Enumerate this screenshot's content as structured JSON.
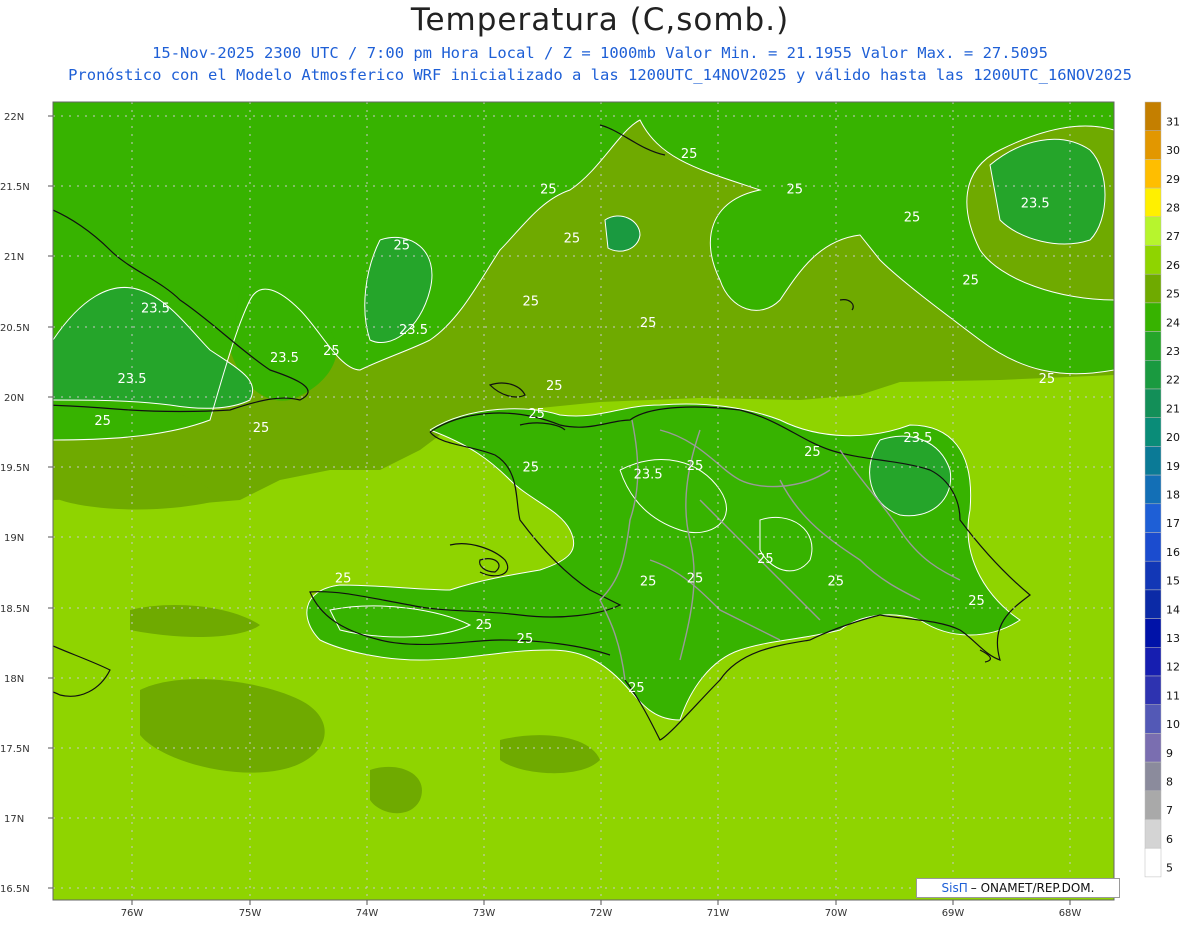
{
  "header": {
    "title": "Temperatura (C,somb.)",
    "line1": "15-Nov-2025  2300 UTC / 7:00 pm Hora Local / Z = 1000mb   Valor Min. = 21.1955  Valor Max. = 27.5095",
    "line2": "Pronóstico con el Modelo Atmosferico WRF inicializado a las 1200UTC_14NOV2025 y válido hasta las  1200UTC_16NOV2025"
  },
  "axes": {
    "lat_labels": [
      "22N",
      "21.5N",
      "21N",
      "20.5N",
      "20N",
      "19.5N",
      "19N",
      "18.5N",
      "18N",
      "17.5N",
      "17N",
      "16.5N"
    ],
    "lon_labels": [
      "76W",
      "75W",
      "74W",
      "73W",
      "72W",
      "71W",
      "70W",
      "69W",
      "68W"
    ]
  },
  "colorbar": {
    "levels": [
      "31",
      "30",
      "29",
      "28",
      "27",
      "26",
      "25",
      "24",
      "23",
      "22",
      "21",
      "20",
      "19",
      "18",
      "17",
      "16",
      "15",
      "14",
      "13",
      "12",
      "11",
      "10",
      "9",
      "8",
      "7",
      "6",
      "5"
    ],
    "colors": [
      "#c47f00",
      "#e29700",
      "#ffbe00",
      "#fff000",
      "#b7f52d",
      "#8fd400",
      "#6faa00",
      "#37b300",
      "#25a52a",
      "#1a9a40",
      "#138f58",
      "#0a8c78",
      "#0b7a96",
      "#136fb6",
      "#1e5fd6",
      "#1b4ccf",
      "#1237b6",
      "#0b2aa6",
      "#0012a8",
      "#161eb0",
      "#2e33b0",
      "#5359b6",
      "#7a6eb0",
      "#8b8b9c",
      "#a9a9a9",
      "#d4d4d4",
      "#ffffff"
    ]
  },
  "contour_labels": [
    {
      "text": "25",
      "lon": -72.45,
      "lat": 21.45
    },
    {
      "text": "25",
      "lon": -71.25,
      "lat": 21.7
    },
    {
      "text": "25",
      "lon": -70.35,
      "lat": 21.45
    },
    {
      "text": "25",
      "lon": -69.35,
      "lat": 21.25
    },
    {
      "text": "23.5",
      "lon": -68.3,
      "lat": 21.35
    },
    {
      "text": "25",
      "lon": -72.25,
      "lat": 21.1
    },
    {
      "text": "25",
      "lon": -73.7,
      "lat": 21.05
    },
    {
      "text": "25",
      "lon": -72.6,
      "lat": 20.65
    },
    {
      "text": "25",
      "lon": -71.6,
      "lat": 20.5
    },
    {
      "text": "25",
      "lon": -68.85,
      "lat": 20.8
    },
    {
      "text": "23.5",
      "lon": -75.8,
      "lat": 20.6
    },
    {
      "text": "23.5",
      "lon": -73.6,
      "lat": 20.45
    },
    {
      "text": "25",
      "lon": -74.3,
      "lat": 20.3
    },
    {
      "text": "23.5",
      "lon": -74.7,
      "lat": 20.25
    },
    {
      "text": "23.5",
      "lon": -76.0,
      "lat": 20.1
    },
    {
      "text": "25",
      "lon": -72.4,
      "lat": 20.05
    },
    {
      "text": "25",
      "lon": -68.2,
      "lat": 20.1
    },
    {
      "text": "25",
      "lon": -72.55,
      "lat": 19.85
    },
    {
      "text": "25",
      "lon": -76.25,
      "lat": 19.8
    },
    {
      "text": "25",
      "lon": -74.9,
      "lat": 19.75
    },
    {
      "text": "23.5",
      "lon": -69.3,
      "lat": 19.68
    },
    {
      "text": "25",
      "lon": -70.2,
      "lat": 19.58
    },
    {
      "text": "25",
      "lon": -71.2,
      "lat": 19.48
    },
    {
      "text": "25",
      "lon": -72.6,
      "lat": 19.47
    },
    {
      "text": "23.5",
      "lon": -71.6,
      "lat": 19.42
    },
    {
      "text": "25",
      "lon": -70.6,
      "lat": 18.82
    },
    {
      "text": "25",
      "lon": -74.2,
      "lat": 18.68
    },
    {
      "text": "25",
      "lon": -71.2,
      "lat": 18.68
    },
    {
      "text": "25",
      "lon": -71.6,
      "lat": 18.66
    },
    {
      "text": "25",
      "lon": -70.0,
      "lat": 18.66
    },
    {
      "text": "25",
      "lon": -68.8,
      "lat": 18.52
    },
    {
      "text": "25",
      "lon": -73.0,
      "lat": 18.35
    },
    {
      "text": "25",
      "lon": -72.65,
      "lat": 18.25
    },
    {
      "text": "25",
      "lon": -71.7,
      "lat": 17.9
    }
  ],
  "credit": {
    "brand": "SisΠ",
    "text": "– ONAMET/REP.DOM."
  }
}
